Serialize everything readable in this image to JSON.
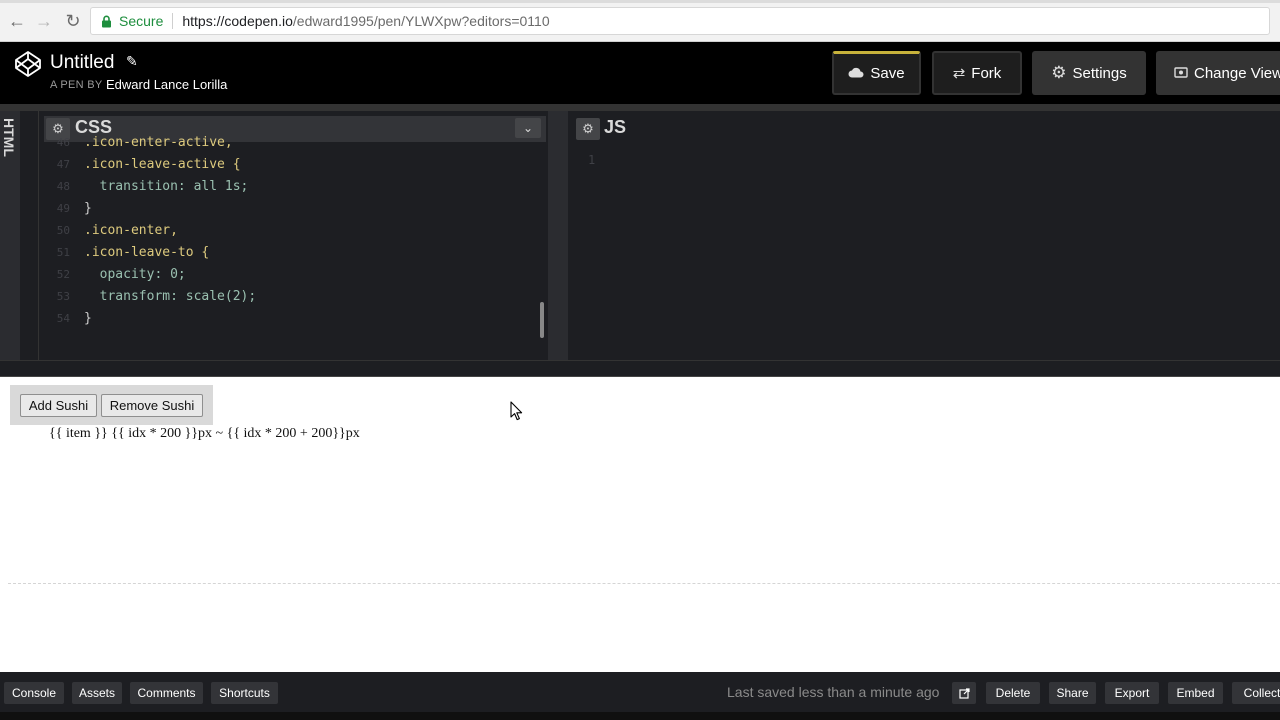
{
  "browser": {
    "secure_label": "Secure",
    "url_host": "https://codepen.io",
    "url_path": "/edward1995/pen/YLWXpw?editors=0110"
  },
  "pen": {
    "title": "Untitled",
    "by_label": "A PEN BY",
    "author": "Edward Lance Lorilla"
  },
  "header_buttons": {
    "save": "Save",
    "fork": "Fork",
    "settings": "Settings",
    "change_view": "Change View"
  },
  "editors": {
    "html_label": "HTML",
    "css_label": "CSS",
    "js_label": "JS",
    "js_line_number": "1"
  },
  "css_code": [
    {
      "ln": "46",
      "text": ".icon-enter-active,"
    },
    {
      "ln": "47",
      "text": ".icon-leave-active {"
    },
    {
      "ln": "48",
      "text": "  transition: all 1s;"
    },
    {
      "ln": "49",
      "text": "}"
    },
    {
      "ln": "50",
      "text": ".icon-enter,"
    },
    {
      "ln": "51",
      "text": ".icon-leave-to {"
    },
    {
      "ln": "52",
      "text": "  opacity: 0;"
    },
    {
      "ln": "53",
      "text": "  transform: scale(2);"
    },
    {
      "ln": "54",
      "text": "}"
    }
  ],
  "preview": {
    "add_button": "Add Sushi",
    "remove_button": "Remove Sushi",
    "template_text": "{{ item }} {{ idx * 200 }}px ~ {{ idx * 200 + 200}}px"
  },
  "footer": {
    "console": "Console",
    "assets": "Assets",
    "comments": "Comments",
    "shortcuts": "Shortcuts",
    "last_saved": "Last saved less than a minute ago",
    "delete": "Delete",
    "share": "Share",
    "export": "Export",
    "embed": "Embed",
    "collect": "Collect"
  },
  "colors": {
    "secure_green": "#1e8e3e",
    "editor_bg": "#1d1e22",
    "save_accent": "#c7b23b"
  }
}
